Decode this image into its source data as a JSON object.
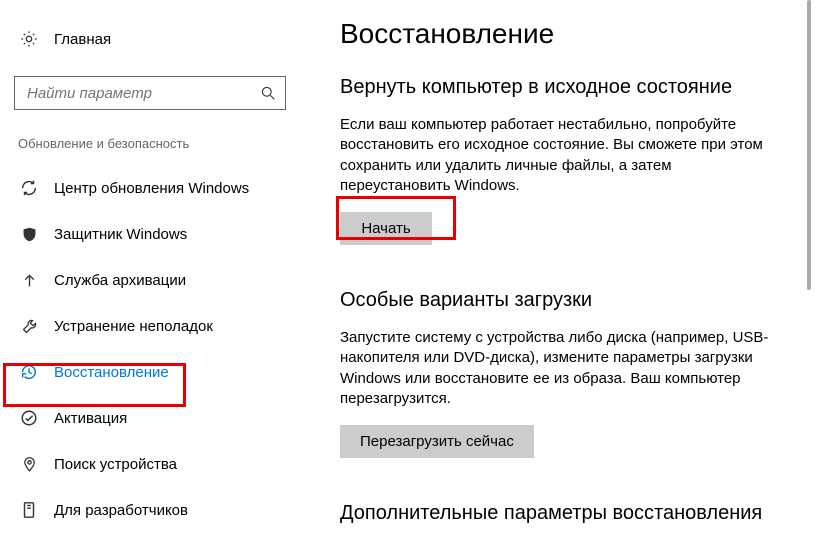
{
  "sidebar": {
    "home_label": "Главная",
    "search_placeholder": "Найти параметр",
    "section_label": "Обновление и безопасность",
    "items": [
      {
        "label": "Центр обновления Windows"
      },
      {
        "label": "Защитник Windows"
      },
      {
        "label": "Служба архивации"
      },
      {
        "label": "Устранение неполадок"
      },
      {
        "label": "Восстановление"
      },
      {
        "label": "Активация"
      },
      {
        "label": "Поиск устройства"
      },
      {
        "label": "Для разработчиков"
      }
    ]
  },
  "content": {
    "page_title": "Восстановление",
    "reset": {
      "heading": "Вернуть компьютер в исходное состояние",
      "body": "Если ваш компьютер работает нестабильно, попробуйте восстановить его исходное состояние. Вы сможете при этом сохранить или удалить личные файлы, а затем переустановить Windows.",
      "button": "Начать"
    },
    "advanced": {
      "heading": "Особые варианты загрузки",
      "body": "Запустите систему с устройства либо диска (например, USB-накопителя или DVD-диска), измените параметры загрузки Windows или восстановите ее из образа. Ваш компьютер перезагрузится.",
      "button": "Перезагрузить сейчас"
    },
    "more": {
      "heading": "Дополнительные параметры восстановления"
    }
  }
}
